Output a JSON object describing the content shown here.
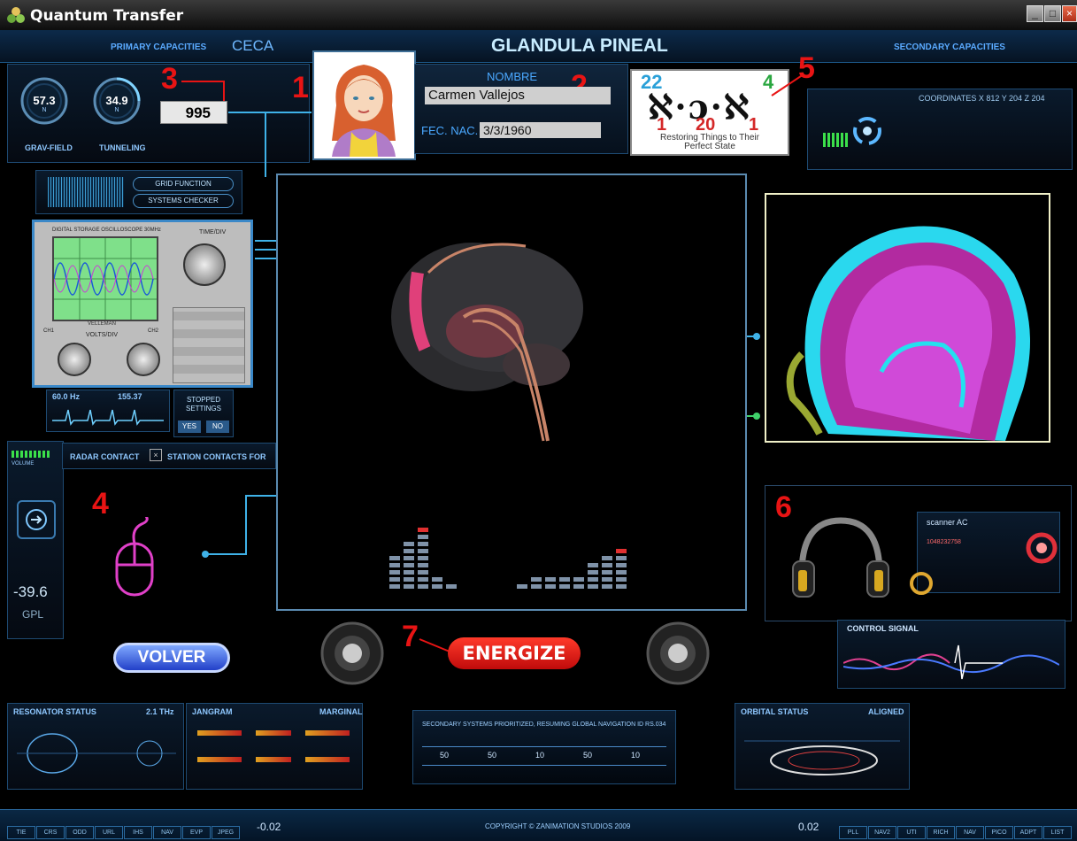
{
  "window": {
    "title": "Quantum Transfer"
  },
  "header": {
    "primary_capacities": "PRIMARY CAPACITIES",
    "ceca": "CECA",
    "main_title": "GLANDULA PINEAL",
    "secondary_capacities": "SECONDARY CAPACITIES"
  },
  "gauges": [
    {
      "value": "57.3",
      "unit": "N",
      "label": "GRAV-FIELD"
    },
    {
      "value": "34.9",
      "unit": "N",
      "label": "TUNNELING"
    }
  ],
  "counter": {
    "value": "995"
  },
  "numbers": {
    "n1": "1",
    "n2": "2",
    "n3": "3",
    "n4": "4",
    "n5": "5",
    "n6": "6",
    "n7": "7"
  },
  "profile": {
    "name_label": "NOMBRE",
    "name_value": "Carmen Vallejos",
    "dob_label": "FEC. NAC.",
    "dob_value": "3/3/1960"
  },
  "hebrew_card": {
    "top_left": "22",
    "top_right": "4",
    "glyphs": "ℵ·ɔ·ℵ",
    "bottom": [
      "1",
      "20",
      "1"
    ],
    "caption_line1": "Restoring Things to Their",
    "caption_line2": "Perfect State"
  },
  "coords": {
    "text": "COORDINATES  X 812   Y 204   Z 204"
  },
  "left_tools": {
    "grid_function": "GRID FUNCTION",
    "systems_checker": "SYSTEMS CHECKER",
    "oscilloscope_title": "DIGITAL STORAGE OSCILLOSCOPE 30MHz",
    "time_div": "TIME/DIV",
    "volts_div": "VOLTS/DIV",
    "ch1": "CH1",
    "ch2": "CH2",
    "brand": "VELLEMAN",
    "freq_label": "60.0 Hz",
    "amp_label": "155.37",
    "status_box_line1": "STOPPED",
    "status_box_line2": "SETTINGS",
    "yes_label": "YES",
    "no_label": "NO"
  },
  "radar": {
    "radar_contact": "RADAR CONTACT",
    "station_contacts": "STATION CONTACTS FOR",
    "volume_label": "VOLUME",
    "gpl_value": "-39.6",
    "gpl_label": "GPL"
  },
  "buttons": {
    "volver": "VOLVER",
    "energize": "ENERGIZE"
  },
  "right_panel": {
    "scanner_label": "scanner AC",
    "scanner_code": "1048232758",
    "control_signal": "CONTROL SIGNAL"
  },
  "bottom": {
    "resonator_status": "RESONATOR STATUS",
    "resonator_value": "2.1 THz",
    "jangram": "JANGRAM",
    "marginal": "MARGINAL",
    "secondary_msg": "SECONDARY SYSTEMS PRIORITIZED, RESUMING GLOBAL NAVIGATION ID RS.034",
    "orbital_status": "ORBITAL STATUS",
    "aligned": "ALIGNED",
    "copyright": "COPYRIGHT © ZANIMATION STUDIOS 2009",
    "left_readout": "-0.02",
    "right_readout": "0.02",
    "left_tabs": [
      "TIE",
      "CRS",
      "ODD",
      "URL",
      "IHS",
      "NAV",
      "EVP",
      "JPEG"
    ],
    "right_tabs": [
      "PLL",
      "NAV2",
      "UTI",
      "RICH",
      "NAV",
      "PICO",
      "ADPT",
      "LIST"
    ],
    "scale_marks": [
      "50",
      "50",
      "10",
      "50",
      "10"
    ]
  },
  "colors": {
    "accent": "#3fb2e8",
    "energize": "#e01515",
    "number_red": "#e81414"
  }
}
